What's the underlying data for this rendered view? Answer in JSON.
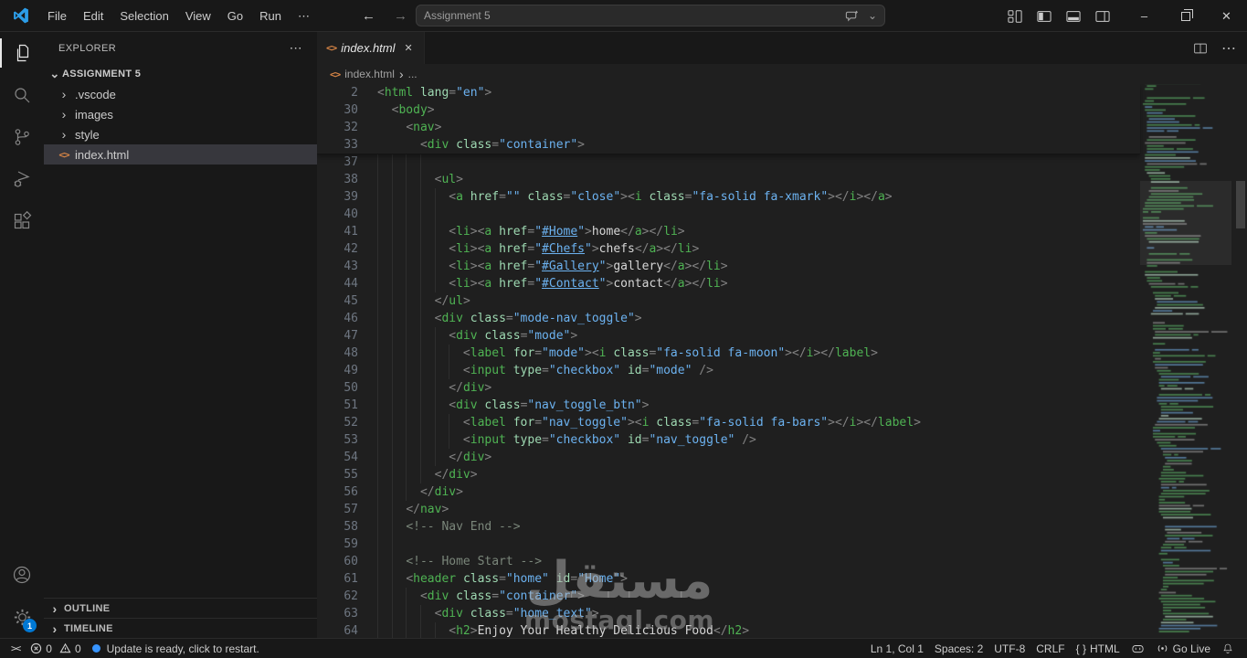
{
  "title_bar": {
    "menus": [
      "File",
      "Edit",
      "Selection",
      "View",
      "Go",
      "Run",
      "⋯"
    ],
    "command_center": "Assignment 5"
  },
  "activity_bar": {
    "settings_badge": "1"
  },
  "explorer": {
    "header": "EXPLORER",
    "root": "ASSIGNMENT 5",
    "items": [
      {
        "label": ".vscode",
        "kind": "folder"
      },
      {
        "label": "images",
        "kind": "folder"
      },
      {
        "label": "style",
        "kind": "folder"
      },
      {
        "label": "index.html",
        "kind": "file",
        "selected": true
      }
    ],
    "sections": [
      "OUTLINE",
      "TIMELINE"
    ]
  },
  "tabs": {
    "active": "index.html"
  },
  "breadcrumb": {
    "file": "index.html",
    "more": "..."
  },
  "icons": {
    "html_file": "<>",
    "chevron_right": "›",
    "chevron_down": "⌄",
    "more": "⋯",
    "close": "✕",
    "back": "←",
    "forward": "→",
    "remote": "><",
    "minimize": "–",
    "command_chevron": "⌄"
  },
  "editor": {
    "sticky": [
      {
        "n": 2,
        "i": 0,
        "t": [
          [
            "p",
            "<"
          ],
          [
            "t",
            "html"
          ],
          [
            "w",
            " "
          ],
          [
            "a",
            "lang"
          ],
          [
            "p",
            "="
          ],
          [
            "s",
            "\"en\""
          ],
          [
            "p",
            ">"
          ]
        ]
      },
      {
        "n": 30,
        "i": 2,
        "t": [
          [
            "p",
            "<"
          ],
          [
            "t",
            "body"
          ],
          [
            "p",
            ">"
          ]
        ]
      },
      {
        "n": 32,
        "i": 4,
        "t": [
          [
            "p",
            "<"
          ],
          [
            "t",
            "nav"
          ],
          [
            "p",
            ">"
          ]
        ]
      },
      {
        "n": 33,
        "i": 6,
        "t": [
          [
            "p",
            "<"
          ],
          [
            "t",
            "div"
          ],
          [
            "w",
            " "
          ],
          [
            "a",
            "class"
          ],
          [
            "p",
            "="
          ],
          [
            "s",
            "\"container\""
          ],
          [
            "p",
            ">"
          ]
        ]
      }
    ],
    "lines": [
      {
        "n": 37,
        "i": 8,
        "t": []
      },
      {
        "n": 38,
        "i": 8,
        "t": [
          [
            "p",
            "<"
          ],
          [
            "t",
            "ul"
          ],
          [
            "p",
            ">"
          ]
        ]
      },
      {
        "n": 39,
        "i": 10,
        "t": [
          [
            "p",
            "<"
          ],
          [
            "t",
            "a"
          ],
          [
            "w",
            " "
          ],
          [
            "a",
            "href"
          ],
          [
            "p",
            "="
          ],
          [
            "s",
            "\"\""
          ],
          [
            "w",
            " "
          ],
          [
            "a",
            "class"
          ],
          [
            "p",
            "="
          ],
          [
            "s",
            "\"close\""
          ],
          [
            "p",
            "><"
          ],
          [
            "t",
            "i"
          ],
          [
            "w",
            " "
          ],
          [
            "a",
            "class"
          ],
          [
            "p",
            "="
          ],
          [
            "s",
            "\"fa-solid fa-xmark\""
          ],
          [
            "p",
            "></"
          ],
          [
            "t",
            "i"
          ],
          [
            "p",
            "></"
          ],
          [
            "t",
            "a"
          ],
          [
            "p",
            ">"
          ]
        ]
      },
      {
        "n": 40,
        "i": 10,
        "t": []
      },
      {
        "n": 41,
        "i": 10,
        "t": [
          [
            "p",
            "<"
          ],
          [
            "t",
            "li"
          ],
          [
            "p",
            "><"
          ],
          [
            "t",
            "a"
          ],
          [
            "w",
            " "
          ],
          [
            "a",
            "href"
          ],
          [
            "p",
            "="
          ],
          [
            "s",
            "\""
          ],
          [
            "u",
            "#Home"
          ],
          [
            "s",
            "\""
          ],
          [
            "p",
            ">"
          ],
          [
            "x",
            "home"
          ],
          [
            "p",
            "</"
          ],
          [
            "t",
            "a"
          ],
          [
            "p",
            "></"
          ],
          [
            "t",
            "li"
          ],
          [
            "p",
            ">"
          ]
        ]
      },
      {
        "n": 42,
        "i": 10,
        "t": [
          [
            "p",
            "<"
          ],
          [
            "t",
            "li"
          ],
          [
            "p",
            "><"
          ],
          [
            "t",
            "a"
          ],
          [
            "w",
            " "
          ],
          [
            "a",
            "href"
          ],
          [
            "p",
            "="
          ],
          [
            "s",
            "\""
          ],
          [
            "u",
            "#Chefs"
          ],
          [
            "s",
            "\""
          ],
          [
            "p",
            ">"
          ],
          [
            "x",
            "chefs"
          ],
          [
            "p",
            "</"
          ],
          [
            "t",
            "a"
          ],
          [
            "p",
            "></"
          ],
          [
            "t",
            "li"
          ],
          [
            "p",
            ">"
          ]
        ]
      },
      {
        "n": 43,
        "i": 10,
        "t": [
          [
            "p",
            "<"
          ],
          [
            "t",
            "li"
          ],
          [
            "p",
            "><"
          ],
          [
            "t",
            "a"
          ],
          [
            "w",
            " "
          ],
          [
            "a",
            "href"
          ],
          [
            "p",
            "="
          ],
          [
            "s",
            "\""
          ],
          [
            "u",
            "#Gallery"
          ],
          [
            "s",
            "\""
          ],
          [
            "p",
            ">"
          ],
          [
            "x",
            "gallery"
          ],
          [
            "p",
            "</"
          ],
          [
            "t",
            "a"
          ],
          [
            "p",
            "></"
          ],
          [
            "t",
            "li"
          ],
          [
            "p",
            ">"
          ]
        ]
      },
      {
        "n": 44,
        "i": 10,
        "t": [
          [
            "p",
            "<"
          ],
          [
            "t",
            "li"
          ],
          [
            "p",
            "><"
          ],
          [
            "t",
            "a"
          ],
          [
            "w",
            " "
          ],
          [
            "a",
            "href"
          ],
          [
            "p",
            "="
          ],
          [
            "s",
            "\""
          ],
          [
            "u",
            "#Contact"
          ],
          [
            "s",
            "\""
          ],
          [
            "p",
            ">"
          ],
          [
            "x",
            "contact"
          ],
          [
            "p",
            "</"
          ],
          [
            "t",
            "a"
          ],
          [
            "p",
            "></"
          ],
          [
            "t",
            "li"
          ],
          [
            "p",
            ">"
          ]
        ]
      },
      {
        "n": 45,
        "i": 8,
        "t": [
          [
            "p",
            "</"
          ],
          [
            "t",
            "ul"
          ],
          [
            "p",
            ">"
          ]
        ]
      },
      {
        "n": 46,
        "i": 8,
        "t": [
          [
            "p",
            "<"
          ],
          [
            "t",
            "div"
          ],
          [
            "w",
            " "
          ],
          [
            "a",
            "class"
          ],
          [
            "p",
            "="
          ],
          [
            "s",
            "\"mode-nav_toggle\""
          ],
          [
            "p",
            ">"
          ]
        ]
      },
      {
        "n": 47,
        "i": 10,
        "t": [
          [
            "p",
            "<"
          ],
          [
            "t",
            "div"
          ],
          [
            "w",
            " "
          ],
          [
            "a",
            "class"
          ],
          [
            "p",
            "="
          ],
          [
            "s",
            "\"mode\""
          ],
          [
            "p",
            ">"
          ]
        ]
      },
      {
        "n": 48,
        "i": 12,
        "t": [
          [
            "p",
            "<"
          ],
          [
            "t",
            "label"
          ],
          [
            "w",
            " "
          ],
          [
            "a",
            "for"
          ],
          [
            "p",
            "="
          ],
          [
            "s",
            "\"mode\""
          ],
          [
            "p",
            "><"
          ],
          [
            "t",
            "i"
          ],
          [
            "w",
            " "
          ],
          [
            "a",
            "class"
          ],
          [
            "p",
            "="
          ],
          [
            "s",
            "\"fa-solid fa-moon\""
          ],
          [
            "p",
            "></"
          ],
          [
            "t",
            "i"
          ],
          [
            "p",
            "></"
          ],
          [
            "t",
            "label"
          ],
          [
            "p",
            ">"
          ]
        ]
      },
      {
        "n": 49,
        "i": 12,
        "t": [
          [
            "p",
            "<"
          ],
          [
            "t",
            "input"
          ],
          [
            "w",
            " "
          ],
          [
            "a",
            "type"
          ],
          [
            "p",
            "="
          ],
          [
            "s",
            "\"checkbox\""
          ],
          [
            "w",
            " "
          ],
          [
            "a",
            "id"
          ],
          [
            "p",
            "="
          ],
          [
            "s",
            "\"mode\""
          ],
          [
            "w",
            " "
          ],
          [
            "p",
            "/>"
          ]
        ]
      },
      {
        "n": 50,
        "i": 10,
        "t": [
          [
            "p",
            "</"
          ],
          [
            "t",
            "div"
          ],
          [
            "p",
            ">"
          ]
        ]
      },
      {
        "n": 51,
        "i": 10,
        "t": [
          [
            "p",
            "<"
          ],
          [
            "t",
            "div"
          ],
          [
            "w",
            " "
          ],
          [
            "a",
            "class"
          ],
          [
            "p",
            "="
          ],
          [
            "s",
            "\"nav_toggle_btn\""
          ],
          [
            "p",
            ">"
          ]
        ]
      },
      {
        "n": 52,
        "i": 12,
        "t": [
          [
            "p",
            "<"
          ],
          [
            "t",
            "label"
          ],
          [
            "w",
            " "
          ],
          [
            "a",
            "for"
          ],
          [
            "p",
            "="
          ],
          [
            "s",
            "\"nav_toggle\""
          ],
          [
            "p",
            "><"
          ],
          [
            "t",
            "i"
          ],
          [
            "w",
            " "
          ],
          [
            "a",
            "class"
          ],
          [
            "p",
            "="
          ],
          [
            "s",
            "\"fa-solid fa-bars\""
          ],
          [
            "p",
            "></"
          ],
          [
            "t",
            "i"
          ],
          [
            "p",
            "></"
          ],
          [
            "t",
            "label"
          ],
          [
            "p",
            ">"
          ]
        ]
      },
      {
        "n": 53,
        "i": 12,
        "t": [
          [
            "p",
            "<"
          ],
          [
            "t",
            "input"
          ],
          [
            "w",
            " "
          ],
          [
            "a",
            "type"
          ],
          [
            "p",
            "="
          ],
          [
            "s",
            "\"checkbox\""
          ],
          [
            "w",
            " "
          ],
          [
            "a",
            "id"
          ],
          [
            "p",
            "="
          ],
          [
            "s",
            "\"nav_toggle\""
          ],
          [
            "w",
            " "
          ],
          [
            "p",
            "/>"
          ]
        ]
      },
      {
        "n": 54,
        "i": 10,
        "t": [
          [
            "p",
            "</"
          ],
          [
            "t",
            "div"
          ],
          [
            "p",
            ">"
          ]
        ]
      },
      {
        "n": 55,
        "i": 8,
        "t": [
          [
            "p",
            "</"
          ],
          [
            "t",
            "div"
          ],
          [
            "p",
            ">"
          ]
        ]
      },
      {
        "n": 56,
        "i": 6,
        "t": [
          [
            "p",
            "</"
          ],
          [
            "t",
            "div"
          ],
          [
            "p",
            ">"
          ]
        ]
      },
      {
        "n": 57,
        "i": 4,
        "t": [
          [
            "p",
            "</"
          ],
          [
            "t",
            "nav"
          ],
          [
            "p",
            ">"
          ]
        ]
      },
      {
        "n": 58,
        "i": 4,
        "t": [
          [
            "c",
            "<!-- Nav End -->"
          ]
        ]
      },
      {
        "n": 59,
        "i": 4,
        "t": []
      },
      {
        "n": 60,
        "i": 4,
        "t": [
          [
            "c",
            "<!-- Home Start -->"
          ]
        ]
      },
      {
        "n": 61,
        "i": 4,
        "t": [
          [
            "p",
            "<"
          ],
          [
            "t",
            "header"
          ],
          [
            "w",
            " "
          ],
          [
            "a",
            "class"
          ],
          [
            "p",
            "="
          ],
          [
            "s",
            "\"home\""
          ],
          [
            "w",
            " "
          ],
          [
            "a",
            "id"
          ],
          [
            "p",
            "="
          ],
          [
            "s",
            "\"Home\""
          ],
          [
            "p",
            ">"
          ]
        ]
      },
      {
        "n": 62,
        "i": 6,
        "t": [
          [
            "p",
            "<"
          ],
          [
            "t",
            "div"
          ],
          [
            "w",
            " "
          ],
          [
            "a",
            "class"
          ],
          [
            "p",
            "="
          ],
          [
            "s",
            "\"container\""
          ],
          [
            "p",
            ">"
          ]
        ]
      },
      {
        "n": 63,
        "i": 8,
        "t": [
          [
            "p",
            "<"
          ],
          [
            "t",
            "div"
          ],
          [
            "w",
            " "
          ],
          [
            "a",
            "class"
          ],
          [
            "p",
            "="
          ],
          [
            "s",
            "\"home_text\""
          ],
          [
            "p",
            ">"
          ]
        ]
      },
      {
        "n": 64,
        "i": 10,
        "t": [
          [
            "p",
            "<"
          ],
          [
            "t",
            "h2"
          ],
          [
            "p",
            ">"
          ],
          [
            "x",
            "Enjoy Your Healthy Delicious Food"
          ],
          [
            "p",
            "</"
          ],
          [
            "t",
            "h2"
          ],
          [
            "p",
            ">"
          ]
        ]
      }
    ]
  },
  "status_bar": {
    "errors": "0",
    "warnings": "0",
    "update_text": "Update is ready, click to restart.",
    "line_col": "Ln 1, Col 1",
    "spaces": "Spaces: 2",
    "encoding": "UTF-8",
    "eol": "CRLF",
    "language_icon": "{ }",
    "language": "HTML",
    "go_live": "Go Live"
  },
  "watermark": {
    "line1": "مستقل",
    "line2": "mostaql.com"
  },
  "colors": {
    "accent": "#0078D4",
    "update_blue": "#3794FF",
    "html_icon_orange": "#D68445",
    "logo_blue": "#2C9DE8",
    "editor_bg": "#1F1F1F",
    "chrome_bg": "#181818",
    "tag_green": "#4FB353",
    "attr_green": "#9ED9B2",
    "string_blue": "#6CB2F0"
  }
}
